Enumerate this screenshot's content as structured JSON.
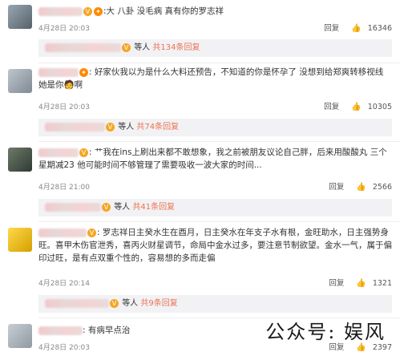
{
  "actions": {
    "reply_label": "回复",
    "like_icon": "thumbs-up-icon"
  },
  "comments": [
    {
      "text": ":大 八卦 没毛病 真有你的罗志祥",
      "time": "4月28日 20:03",
      "likes": "16346",
      "reply_summary": {
        "prefix": "等人",
        "link": "共134条回复"
      }
    },
    {
      "text": ": 好家伙我以为是什么大料还预告，不知道的你是怀孕了 没想到给郑爽转移视线 她是你",
      "text_tail": "啊",
      "time": "4月28日 20:03",
      "likes": "10305",
      "reply_summary": {
        "prefix": "等人",
        "link": "共74条回复"
      }
    },
    {
      "text": ": 艹我在ins上刷出来都不敢想象，我之前被朋友议论自己胖，后来用酸酸丸 三个星期减23 他可能时间不够管理了需要吸收一波大家的时间...",
      "time": "4月28日 21:00",
      "likes": "2566",
      "reply_summary": {
        "prefix": "等人",
        "link": "共41条回复"
      }
    },
    {
      "text": ": 罗志祥日主癸水生在酉月，日主癸水在年支子水有根，金旺助水，日主强势身旺。喜甲木伤官泄秀，喜丙火财星调节，命局中金水过多，要注意节制欲望。金水一气，属于偏印过旺，是有点双重个性的，容易想的多而走偏",
      "time": "4月28日 20:14",
      "likes": "1321",
      "reply_summary": {
        "prefix": "等人",
        "link": "共9条回复"
      }
    },
    {
      "text": ": 有病早点治",
      "time": "4月28日 20:03",
      "likes": "2397"
    }
  ],
  "watermark": "公众号: 娱风"
}
